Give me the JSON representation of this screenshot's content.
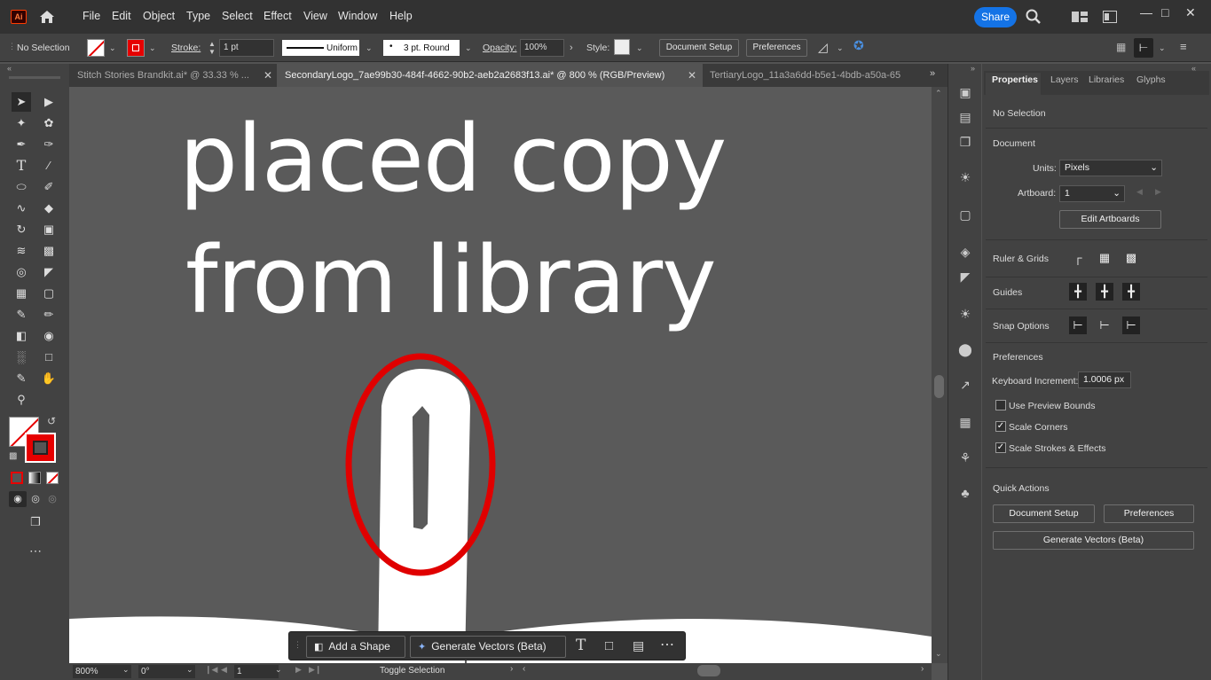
{
  "app": {
    "logo": "Ai",
    "title": "Adobe Illustrator"
  },
  "menu": [
    "File",
    "Edit",
    "Object",
    "Type",
    "Select",
    "Effect",
    "View",
    "Window",
    "Help"
  ],
  "share_label": "Share",
  "controlbar": {
    "selection": "No Selection",
    "stroke_label": "Stroke:",
    "stroke_weight": "1 pt",
    "profile": "Uniform",
    "brush": "3 pt. Round",
    "opacity_label": "Opacity:",
    "opacity": "100%",
    "style_label": "Style:",
    "document_setup": "Document Setup",
    "preferences": "Preferences"
  },
  "tabs": [
    {
      "label": "Stitch Stories Brandkit.ai* @ 33.33 % ...",
      "active": false
    },
    {
      "label": "SecondaryLogo_7ae99b30-484f-4662-90b2-aeb2a2683f13.ai* @ 800 % (RGB/Preview)",
      "active": true
    },
    {
      "label": "TertiaryLogo_11a3a6dd-b5e1-4bdb-a50a-65",
      "active": false
    }
  ],
  "canvas": {
    "line1": "placed copy",
    "line2": "from library",
    "highlight_color": "#e00000"
  },
  "status": {
    "zoom": "800%",
    "rotation": "0°",
    "artboard": "1",
    "mode": "Toggle Selection"
  },
  "context_bar": {
    "add_shape": "Add a Shape",
    "generate": "Generate Vectors (Beta)"
  },
  "panel": {
    "tabs": [
      "Properties",
      "Layers",
      "Libraries",
      "Glyphs"
    ],
    "no_selection": "No Selection",
    "document": "Document",
    "units_label": "Units:",
    "units": "Pixels",
    "artboard_label": "Artboard:",
    "artboard": "1",
    "edit_artboards": "Edit Artboards",
    "ruler_grids": "Ruler & Grids",
    "guides": "Guides",
    "snap_options": "Snap Options",
    "preferences": "Preferences",
    "keyboard_increment_label": "Keyboard Increment:",
    "keyboard_increment": "1.0006 px",
    "use_preview_bounds": "Use Preview Bounds",
    "scale_corners": "Scale Corners",
    "scale_strokes": "Scale Strokes & Effects",
    "quick_actions": "Quick Actions",
    "qa_document_setup": "Document Setup",
    "qa_preferences": "Preferences",
    "qa_generate": "Generate Vectors (Beta)"
  },
  "colors": {
    "accent": "#1473e6",
    "stroke": "#e60000",
    "bg": "#535353"
  }
}
